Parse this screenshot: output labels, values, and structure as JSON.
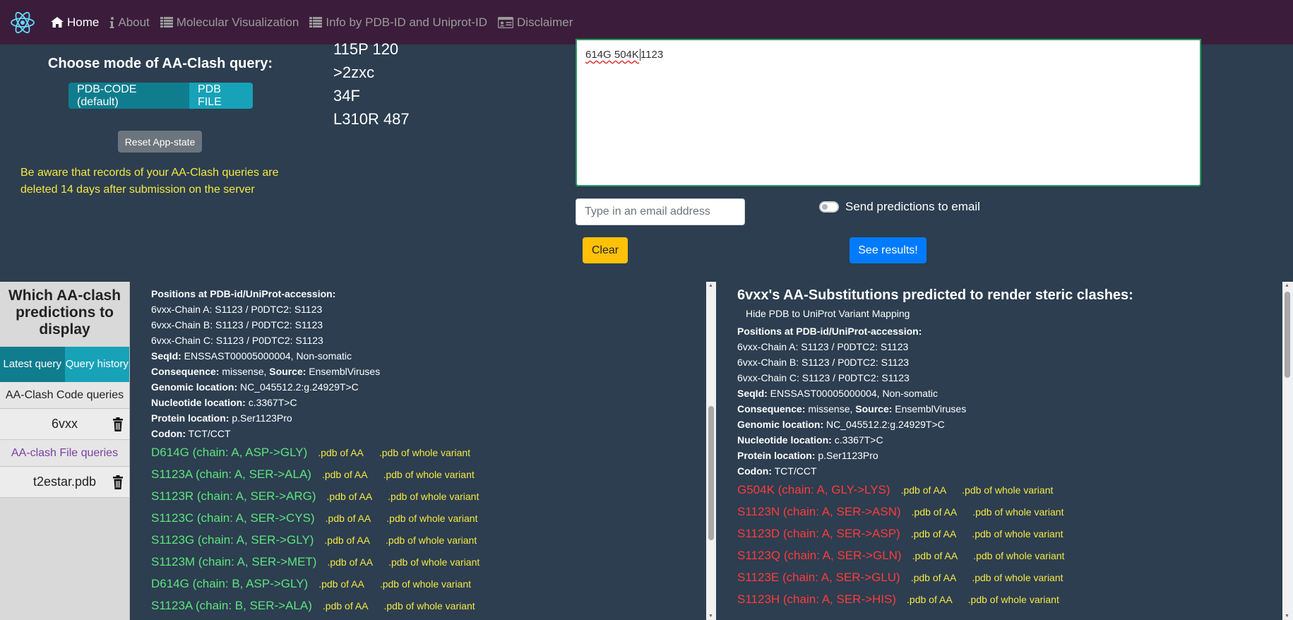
{
  "nav": {
    "logo_icon": "react-atom-icon",
    "items": [
      {
        "label": "Home",
        "icon": "home-icon",
        "active": true
      },
      {
        "label": "About",
        "icon": "info-icon",
        "active": false
      },
      {
        "label": "Molecular Visualization",
        "icon": "list-icon",
        "active": false
      },
      {
        "label": "Info by PDB-ID and Uniprot-ID",
        "icon": "list-icon",
        "active": false
      },
      {
        "label": "Disclaimer",
        "icon": "id-card-icon",
        "active": false
      }
    ]
  },
  "query": {
    "mode_title": "Choose mode of AA-Clash query:",
    "mode_options": [
      "PDB-CODE (default)",
      "PDB FILE"
    ],
    "reset_label": "Reset App-state",
    "warning": "Be aware that records of your AA-Clash queries are deleted 14 days after submission on the server",
    "examples": [
      "115P 120",
      ">2zxc",
      "34F",
      "L310R 487"
    ],
    "input_value_a": "614G 504K",
    "input_value_b": "1123",
    "email_placeholder": "Type in an email address",
    "send_email_label": "Send predictions to email",
    "clear_label": "Clear",
    "results_label": "See results!"
  },
  "sidebar": {
    "title": "Which AA-clash predictions to display",
    "tabs": [
      "Latest query",
      "Query history"
    ],
    "code_header": "AA-Clash Code queries",
    "code_items": [
      "6vxx"
    ],
    "file_header": "AA-clash File queries",
    "file_items": [
      "t2estar.pdb"
    ]
  },
  "mapping": {
    "positions_label": "Positions at PDB-id/UniProt-accession:",
    "chains": [
      "6vxx-Chain A: S1123 / P0DTC2: S1123",
      "6vxx-Chain B: S1123 / P0DTC2: S1123",
      "6vxx-Chain C: S1123 / P0DTC2: S1123"
    ],
    "seqid_label": "SeqId:",
    "seqid_value": "ENSSAST00005000004, Non-somatic",
    "consequence_label": "Consequence:",
    "consequence_value": "missense,",
    "source_label": "Source:",
    "source_value": "EnsemblViruses",
    "genomic_label": "Genomic location:",
    "genomic_value": "NC_045512.2:g.24929T>C",
    "nucleotide_label": "Nucleotide location:",
    "nucleotide_value": "c.3367T>C",
    "protein_label": "Protein location:",
    "protein_value": "p.Ser1123Pro",
    "codon_label": "Codon:",
    "codon_value": "TCT/CCT"
  },
  "left_panel": {
    "link_aa": ".pdb of AA",
    "link_whole": ".pdb of whole variant",
    "variants": [
      "D614G (chain: A, ASP->GLY)",
      "S1123A (chain: A, SER->ALA)",
      "S1123R (chain: A, SER->ARG)",
      "S1123C (chain: A, SER->CYS)",
      "S1123G (chain: A, SER->GLY)",
      "S1123M (chain: A, SER->MET)",
      "D614G (chain: B, ASP->GLY)",
      "S1123A (chain: B, SER->ALA)"
    ]
  },
  "right_panel": {
    "title": "6vxx's AA-Substitutions predicted to render steric clashes:",
    "hide_mapping": "Hide PDB to UniProt Variant Mapping",
    "variants": [
      "G504K (chain: A, GLY->LYS)",
      "S1123N (chain: A, SER->ASN)",
      "S1123D (chain: A, SER->ASP)",
      "S1123Q (chain: A, SER->GLN)",
      "S1123E (chain: A, SER->GLU)",
      "S1123H (chain: A, SER->HIS)"
    ]
  },
  "colors": {
    "navbar": "#3b1d3b",
    "background": "#2c3e50",
    "non_clash": "#5ee37e",
    "clash": "#ff3a3a",
    "link": "#f5e742"
  }
}
